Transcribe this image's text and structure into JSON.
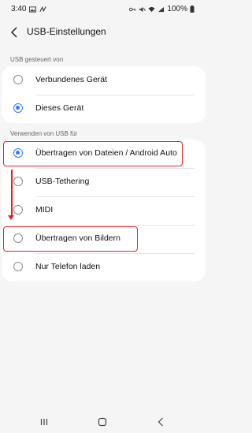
{
  "status_bar": {
    "time": "3:40",
    "battery_percent": "100%",
    "icons": [
      "gallery-icon",
      "nfc-icon",
      "key-icon",
      "mute-icon",
      "wifi-icon",
      "signal-icon",
      "battery-icon"
    ]
  },
  "header": {
    "title": "USB-Einstellungen",
    "back_icon": "back-arrow-icon"
  },
  "sections": [
    {
      "label": "USB gesteuert von",
      "options": [
        {
          "label": "Verbundenes Gerät",
          "selected": false
        },
        {
          "label": "Dieses Gerät",
          "selected": true
        }
      ]
    },
    {
      "label": "Verwenden von USB für",
      "options": [
        {
          "label": "Übertragen von Dateien / Android Auto",
          "selected": true,
          "highlighted": true
        },
        {
          "label": "USB-Tethering",
          "selected": false
        },
        {
          "label": "MIDI",
          "selected": false
        },
        {
          "label": "Übertragen von Bildern",
          "selected": false,
          "highlighted": true
        },
        {
          "label": "Nur Telefon laden",
          "selected": false
        }
      ]
    }
  ],
  "annotation": {
    "color": "#e02424",
    "arrow_from": "Übertragen von Dateien / Android Auto",
    "arrow_to": "Übertragen von Bildern"
  },
  "colors": {
    "accent": "#2d7cf6",
    "background": "#f5f5f6",
    "card": "#ffffff"
  },
  "nav_bar": {
    "icons": [
      "recent-apps-icon",
      "home-icon",
      "back-icon"
    ]
  }
}
